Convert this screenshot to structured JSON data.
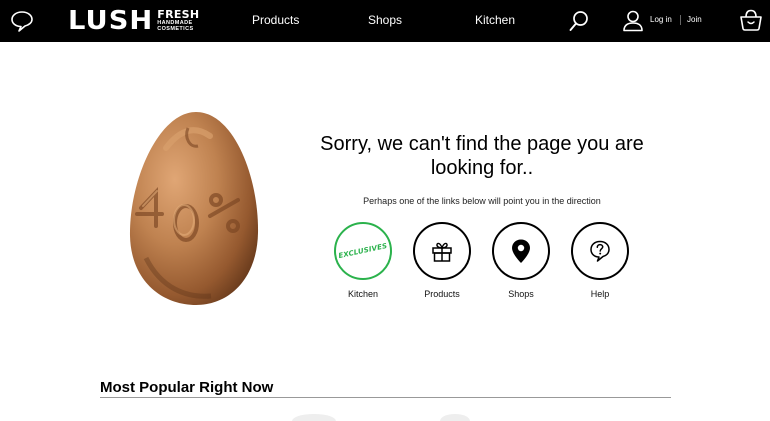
{
  "header": {
    "logo_main": "LUSH",
    "logo_fresh": "FRESH",
    "logo_line2": "HANDMADE",
    "logo_line3": "COSMETICS",
    "nav": [
      {
        "label": "Products"
      },
      {
        "label": "Shops"
      },
      {
        "label": "Kitchen"
      }
    ],
    "login_label": "Log in",
    "join_label": "Join"
  },
  "error": {
    "title": "Sorry, we can't find the page you are looking for..",
    "hint": "Perhaps one of the links below will point you in the direction"
  },
  "quick_links": [
    {
      "label": "Kitchen",
      "badge_text": "EXCLUSIVES",
      "icon": "exclusives-badge",
      "accent": "#2bb24c"
    },
    {
      "label": "Products",
      "icon": "gift-icon"
    },
    {
      "label": "Shops",
      "icon": "map-pin-icon"
    },
    {
      "label": "Help",
      "icon": "question-speech-icon"
    }
  ],
  "popular": {
    "title": "Most Popular Right Now"
  },
  "colors": {
    "header_bg": "#000000",
    "accent_green": "#2bb24c",
    "egg_copper": "#b87a45"
  }
}
